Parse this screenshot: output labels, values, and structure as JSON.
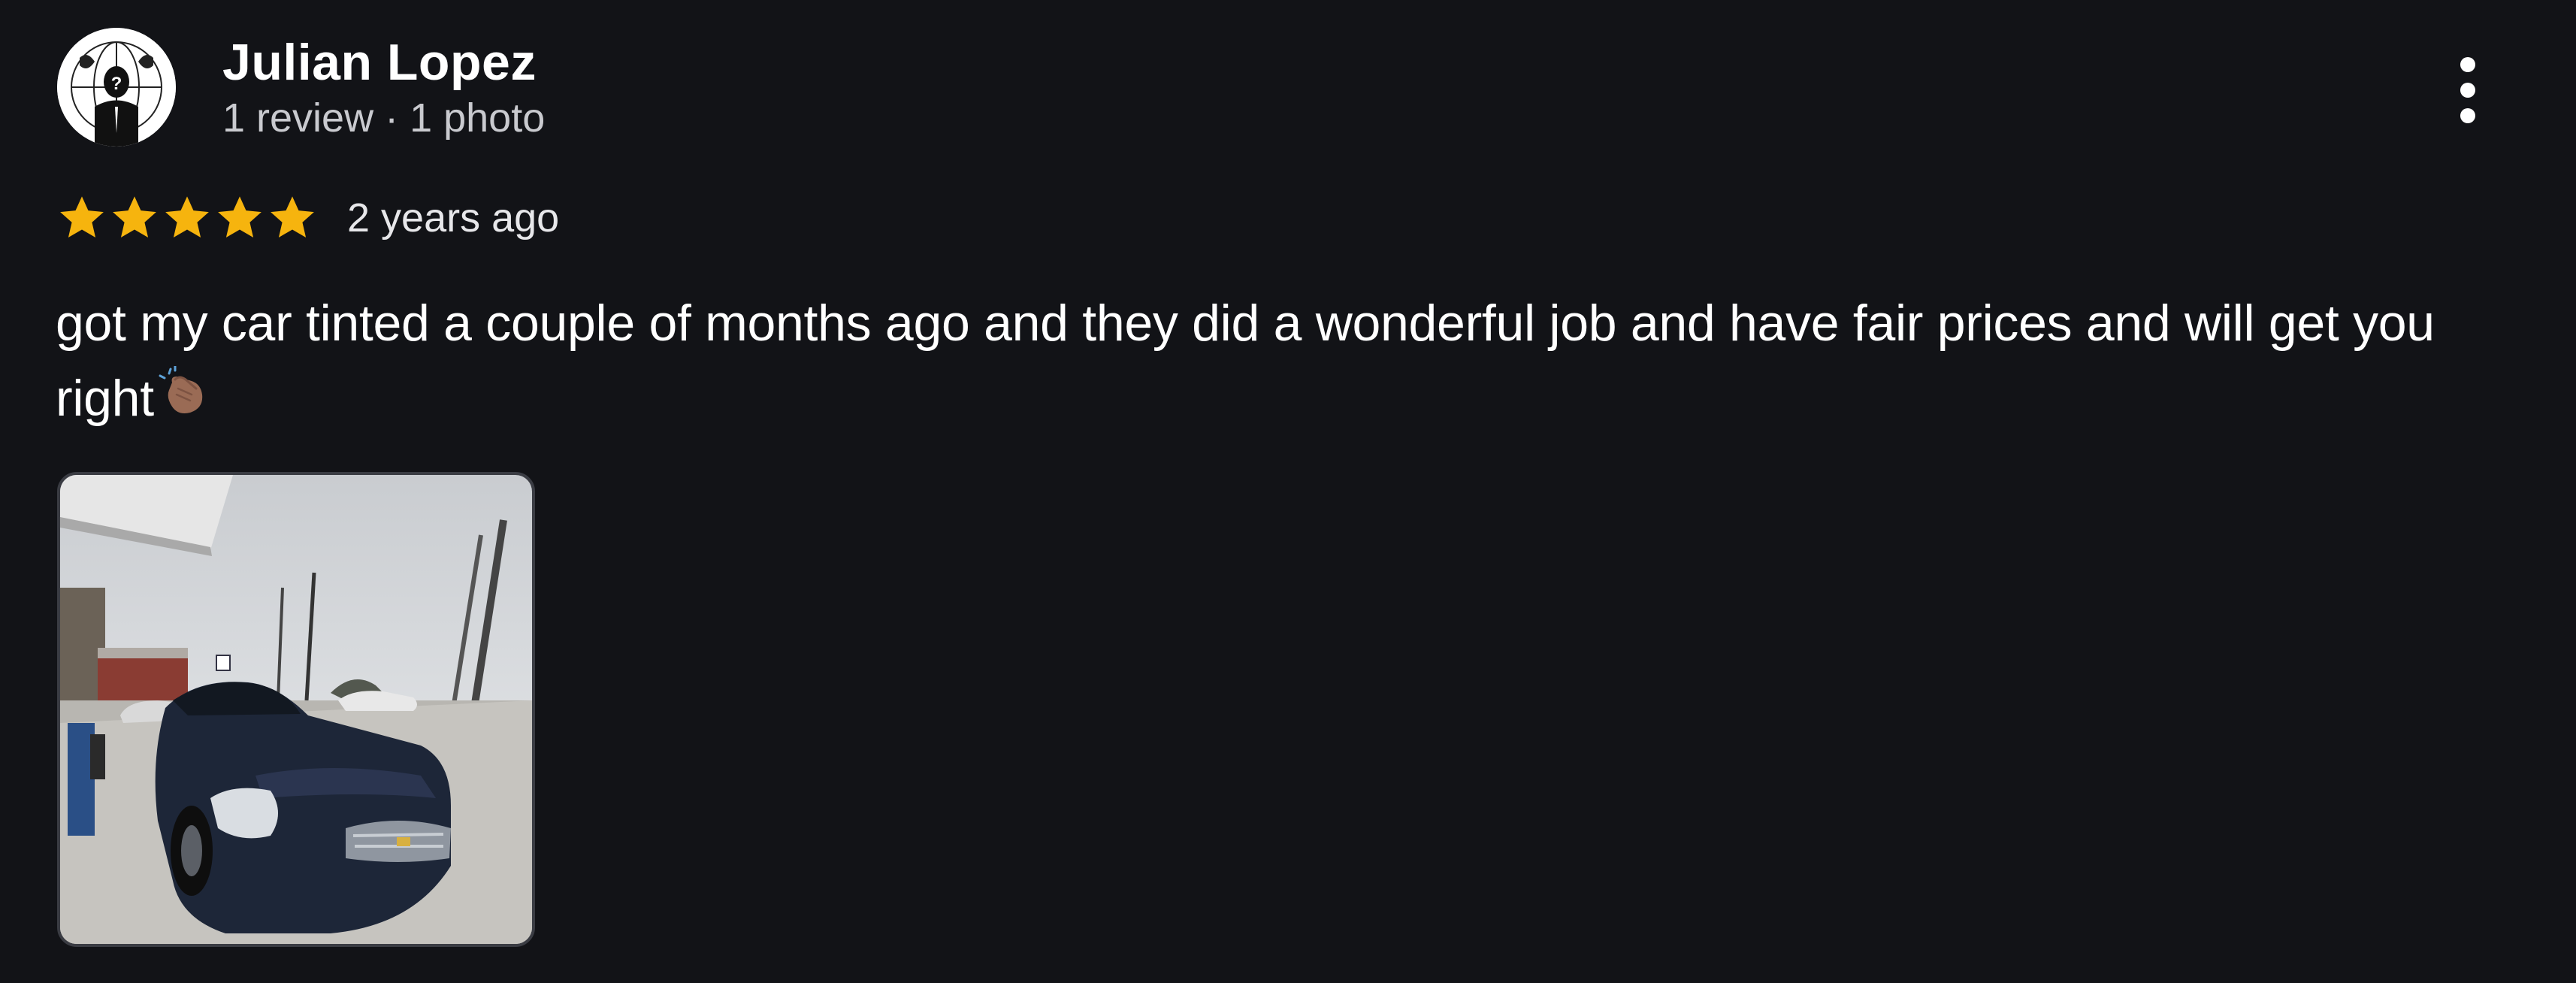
{
  "review": {
    "author_name": "Julian Lopez",
    "author_meta": "1 review · 1 photo",
    "rating": 5,
    "rating_max": 5,
    "date": "2 years ago",
    "text": "got my car tinted a couple of months ago and they did a wonderful job and have fair prices and will get you right",
    "emoji": "clapping-hands",
    "photo_count": 1
  },
  "icons": {
    "avatar": "anonymous-mask-avatar",
    "more": "more-vert-icon",
    "star": "star-icon"
  },
  "colors": {
    "background": "#121317",
    "star": "#f6b40e",
    "text_primary": "#ffffff",
    "text_secondary": "#c9cacf"
  }
}
